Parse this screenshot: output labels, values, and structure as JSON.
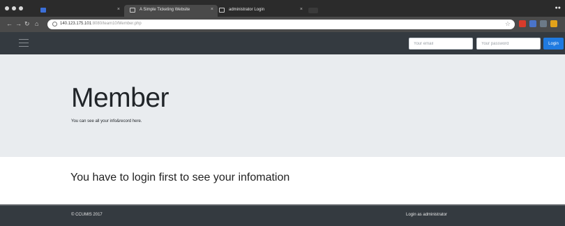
{
  "browser": {
    "tabs": [
      {
        "title": "",
        "active": false
      },
      {
        "title": "A Simple Ticketing Website",
        "active": true
      },
      {
        "title": "administrator Login",
        "active": false
      }
    ],
    "close_glyph": "×",
    "address": {
      "url_main": "140.123.175.101",
      "url_rest": ":8080/team10/Member.php"
    },
    "icons": {
      "back": "back-arrow-icon",
      "forward": "forward-arrow-icon",
      "reload": "reload-icon",
      "bookmark": "star-icon"
    }
  },
  "navbar": {
    "email_placeholder": "Your email",
    "password_placeholder": "Your password",
    "login_label": "Login",
    "colors": {
      "background": "#343a40",
      "login": "#1f7ae0"
    }
  },
  "jumbotron": {
    "title": "Member",
    "lead": "You can see all your info&record here."
  },
  "main": {
    "message": "You have to login first to see your infomation"
  },
  "footer": {
    "copyright": "© CCUMIS 2017",
    "admin_link": "Login as administrator"
  }
}
